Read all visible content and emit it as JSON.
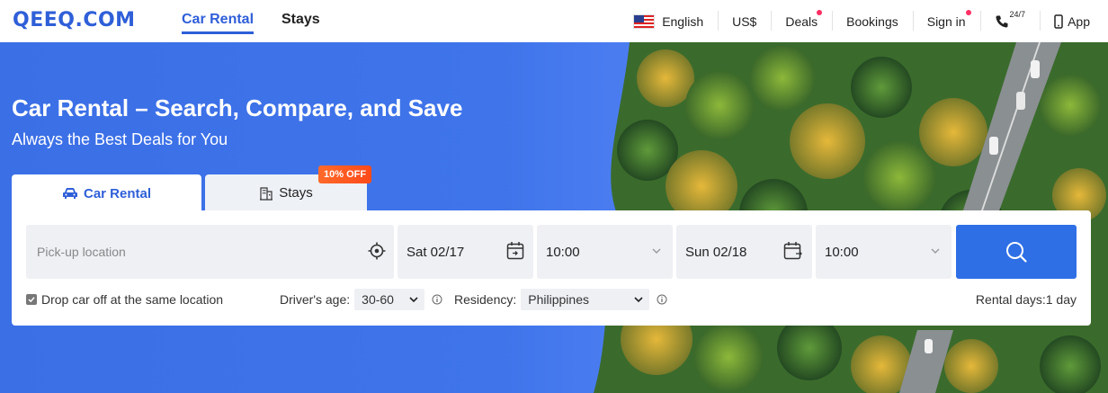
{
  "header": {
    "logo": "QEEQ.COM",
    "tabs": [
      {
        "label": "Car Rental",
        "active": true
      },
      {
        "label": "Stays",
        "active": false
      }
    ],
    "right": {
      "language": "English",
      "currency": "US$",
      "deals": "Deals",
      "bookings": "Bookings",
      "sign_in": "Sign in",
      "support": "24/7",
      "app": "App"
    }
  },
  "hero": {
    "title": "Car Rental – Search, Compare, and Save",
    "subtitle": "Always the Best Deals for You"
  },
  "search_tabs": {
    "car_rental": "Car Rental",
    "stays": "Stays",
    "stays_badge": "10% OFF"
  },
  "search": {
    "pickup_placeholder": "Pick-up location",
    "pickup_date": "Sat 02/17",
    "pickup_time": "10:00",
    "dropoff_date": "Sun 02/18",
    "dropoff_time": "10:00"
  },
  "options": {
    "same_location_label": "Drop car off at the same location",
    "same_location_checked": true,
    "drivers_age_label": "Driver's age:",
    "drivers_age_value": "30-60",
    "residency_label": "Residency:",
    "residency_value": "Philippines",
    "rental_days": "Rental days:1 day"
  },
  "colors": {
    "brand": "#2f5fd8",
    "button": "#2f6fe6",
    "badge": "#ff5a1f",
    "hero": "#3f74ea"
  }
}
